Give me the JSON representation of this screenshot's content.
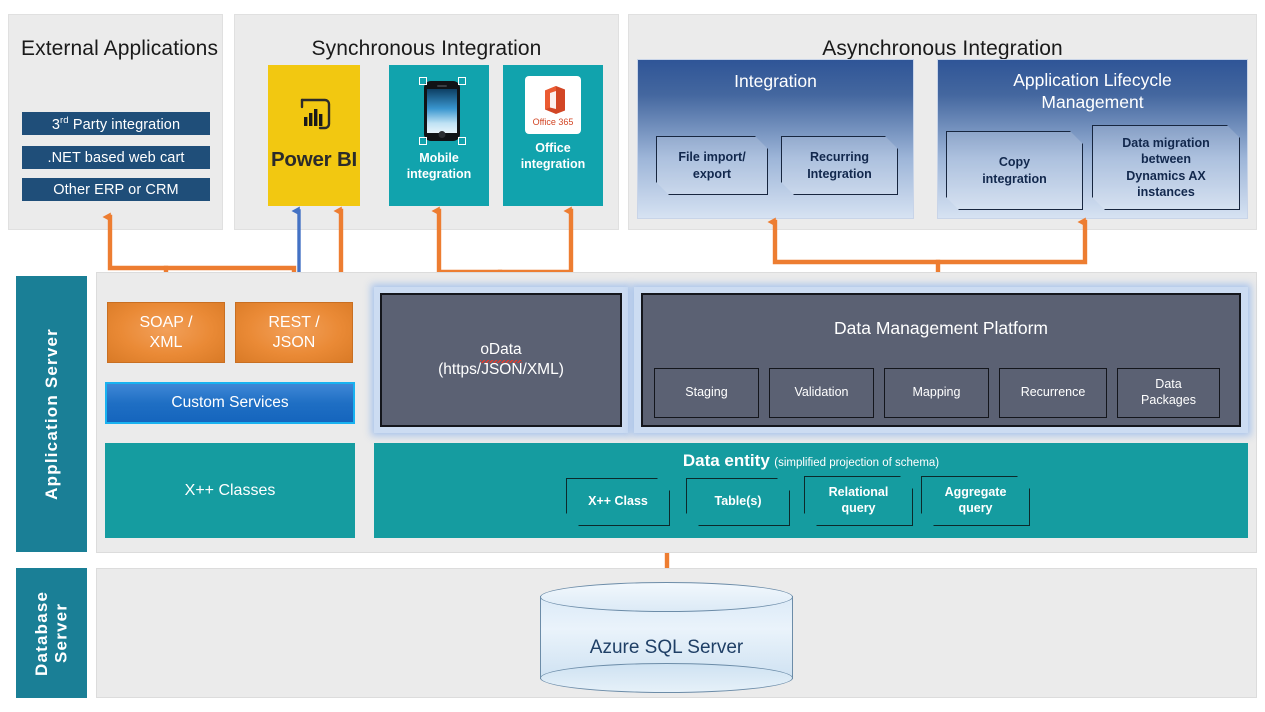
{
  "sections": {
    "external": {
      "title": "External Applications",
      "items": [
        {
          "prefix": "3",
          "sup": "rd",
          "rest": " Party integration"
        },
        {
          "label": ".NET based web cart"
        },
        {
          "label": "Other ERP or CRM"
        }
      ]
    },
    "synchronous": {
      "title": "Synchronous Integration",
      "tiles": [
        {
          "name": "power-bi",
          "logo_word": "Power BI"
        },
        {
          "name": "mobile",
          "label": "Mobile\nintegration",
          "label_line1": "Mobile",
          "label_line2": "integration"
        },
        {
          "name": "office",
          "label_line1": "Office",
          "label_line2": "integration",
          "logo_text": "Office 365"
        }
      ]
    },
    "asynchronous": {
      "title": "Asynchronous Integration",
      "panels": [
        {
          "title": "Integration",
          "boxes": [
            {
              "line1": "File import/",
              "line2": "export"
            },
            {
              "line1": "Recurring",
              "line2": "Integration"
            }
          ]
        },
        {
          "title_line1": "Application Lifecycle",
          "title_line2": "Management",
          "boxes": [
            {
              "line1": "Copy",
              "line2": "integration"
            },
            {
              "line1": "Data migration",
              "line2": "between",
              "line3": "Dynamics AX",
              "line4": "instances"
            }
          ]
        }
      ]
    },
    "application_server": {
      "sidebar_label": "Application Server",
      "soap": {
        "line1": "SOAP /",
        "line2": "XML"
      },
      "rest": {
        "line1": "REST /",
        "line2": "JSON"
      },
      "custom_services": "Custom Services",
      "xpp_classes": "X++ Classes",
      "odata": {
        "title": "oData",
        "subtitle": "(https/JSON/XML)"
      },
      "dmp": {
        "title": "Data Management Platform",
        "cells": [
          {
            "label": "Staging"
          },
          {
            "label": "Validation"
          },
          {
            "label": "Mapping"
          },
          {
            "label": "Recurrence"
          },
          {
            "line1": "Data",
            "line2": "Packages"
          }
        ]
      },
      "data_entity": {
        "title": "Data entity",
        "subtitle": "(simplified projection of schema)",
        "boxes": [
          {
            "line1": "X++ Class"
          },
          {
            "line1": "Table(s)"
          },
          {
            "line1": "Relational",
            "line2": "query"
          },
          {
            "line1": "Aggregate",
            "line2": "query"
          }
        ]
      }
    },
    "database_server": {
      "sidebar_line1": "Database",
      "sidebar_line2": "Server",
      "cylinder_label": "Azure SQL Server"
    }
  },
  "colors": {
    "orange_connector": "#ED7D31",
    "blue_connector": "#4472C4",
    "teal": "#159ca0",
    "navy_pill": "#1f4e79",
    "powerbi_yellow": "#f2c811",
    "tile_teal": "#11a3ad",
    "slate": "#5b6173",
    "sidebar_teal": "#1a7f96",
    "panel_bg": "#ebebeb"
  }
}
